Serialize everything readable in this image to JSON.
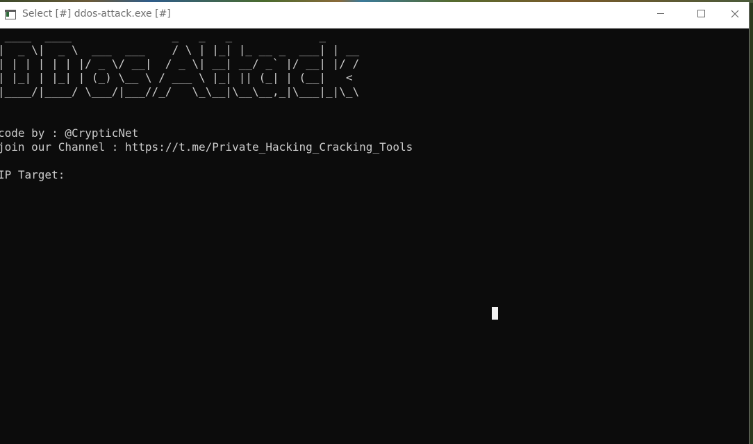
{
  "window": {
    "title": "Select [#] ddos-attack.exe [#]"
  },
  "icons": {
    "app": "console-app-icon",
    "minimize": "minimize-icon",
    "maximize": "maximize-icon",
    "close": "close-icon"
  },
  "console": {
    "banner": " ____  ____               _   _   _             _\n|  _ \\|  _ \\  ___  ___    / \\ | |_| |_ __ _  ___| | __\n| | | | | | |/ _ \\/ __|  / _ \\| __| __/ _` |/ __| |/ /\n| |_| | |_| | (_) \\__ \\ / ___ \\ |_| || (_| | (__|   <\n|____/|____/ \\___/|___//_/   \\_\\__|\\__\\__,_|\\___|_|\\_\\",
    "credit": "code by : @CrypticNet",
    "channel": "join our Channel : https://t.me/Private_Hacking_Cracking_Tools",
    "prompt": "IP Target:"
  },
  "colors": {
    "console_background": "#0c0c0c",
    "console_text": "#cccccc",
    "titlebar": "#ffffff"
  }
}
